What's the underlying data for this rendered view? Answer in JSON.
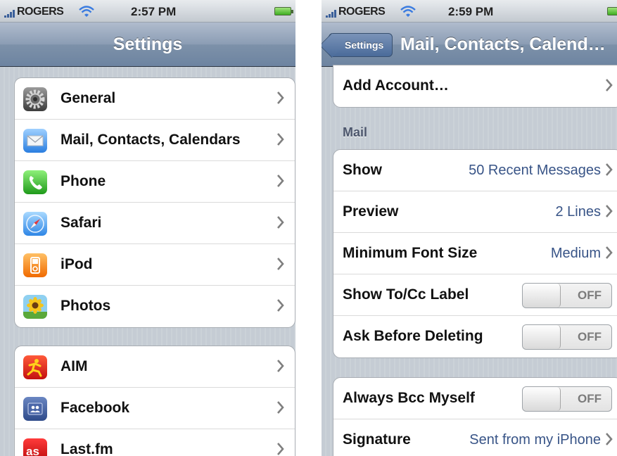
{
  "left": {
    "status": {
      "carrier": "ROGERS",
      "time": "2:57 PM"
    },
    "nav": {
      "title": "Settings"
    },
    "groups": [
      [
        {
          "label": "General",
          "icon": "general-gear-icon"
        },
        {
          "label": "Mail, Contacts, Calendars",
          "icon": "mail-envelope-icon"
        },
        {
          "label": "Phone",
          "icon": "phone-handset-icon"
        },
        {
          "label": "Safari",
          "icon": "safari-compass-icon"
        },
        {
          "label": "iPod",
          "icon": "ipod-icon"
        },
        {
          "label": "Photos",
          "icon": "photos-sunflower-icon"
        }
      ],
      [
        {
          "label": "AIM",
          "icon": "aim-runner-icon"
        },
        {
          "label": "Facebook",
          "icon": "facebook-icon"
        },
        {
          "label": "Last.fm",
          "icon": "lastfm-icon"
        }
      ]
    ]
  },
  "right": {
    "status": {
      "carrier": "ROGERS",
      "time": "2:59 PM"
    },
    "nav": {
      "back_label": "Settings",
      "title": "Mail, Contacts, Calend…"
    },
    "add_account": {
      "label": "Add Account…"
    },
    "mail_section": {
      "header": "Mail",
      "rows": [
        {
          "label": "Show",
          "value": "50 Recent Messages"
        },
        {
          "label": "Preview",
          "value": "2 Lines"
        },
        {
          "label": "Minimum Font Size",
          "value": "Medium"
        },
        {
          "label": "Show To/Cc Label",
          "toggle": "OFF"
        },
        {
          "label": "Ask Before Deleting",
          "toggle": "OFF"
        }
      ]
    },
    "compose_section": {
      "rows": [
        {
          "label": "Always Bcc Myself",
          "toggle": "OFF"
        },
        {
          "label": "Signature",
          "value": "Sent from my iPhone"
        }
      ]
    }
  },
  "colors": {
    "nav_bar": "#6d84a1",
    "value_text": "#385487",
    "background_stripe": "#c5ccd4",
    "battery": "#3fae23",
    "section_header": "#4c566c"
  }
}
